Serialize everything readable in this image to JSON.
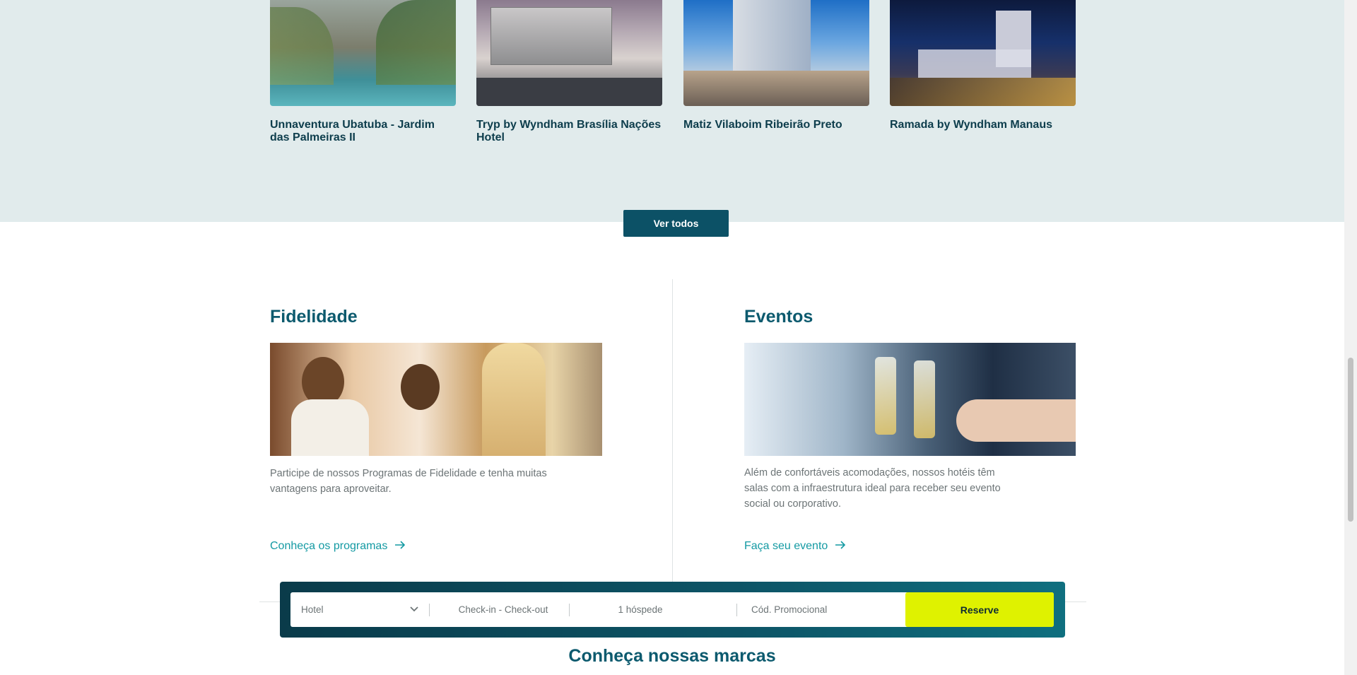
{
  "hotels": [
    {
      "name": "Unnaventura Ubatuba - Jardim das Palmeiras II"
    },
    {
      "name": "Tryp by Wyndham Brasília Nações Hotel"
    },
    {
      "name": "Matiz Vilaboim Ribeirão Preto"
    },
    {
      "name": "Ramada by Wyndham Manaus"
    }
  ],
  "ver_todos_label": "Ver todos",
  "fidelidade": {
    "title": "Fidelidade",
    "text": "Participe de nossos Programas de Fidelidade e tenha muitas vantagens para aproveitar.",
    "link": "Conheça os programas"
  },
  "eventos": {
    "title": "Eventos",
    "text": "Além de confortáveis acomodações, nossos hotéis têm salas com a infraestrutura ideal para receber seu evento social ou corporativo.",
    "link": "Faça seu evento"
  },
  "booking": {
    "hotel_placeholder": "Hotel",
    "dates_placeholder": "Check-in - Check-out",
    "guests": "1 hóspede",
    "promo_placeholder": "Cód. Promocional",
    "reserve_label": "Reserve"
  },
  "brands_title": "Conheça nossas marcas",
  "colors": {
    "accent": "#0c5a6e",
    "link": "#149aa3",
    "reserve": "#dff200",
    "band": "#e1ebec"
  }
}
